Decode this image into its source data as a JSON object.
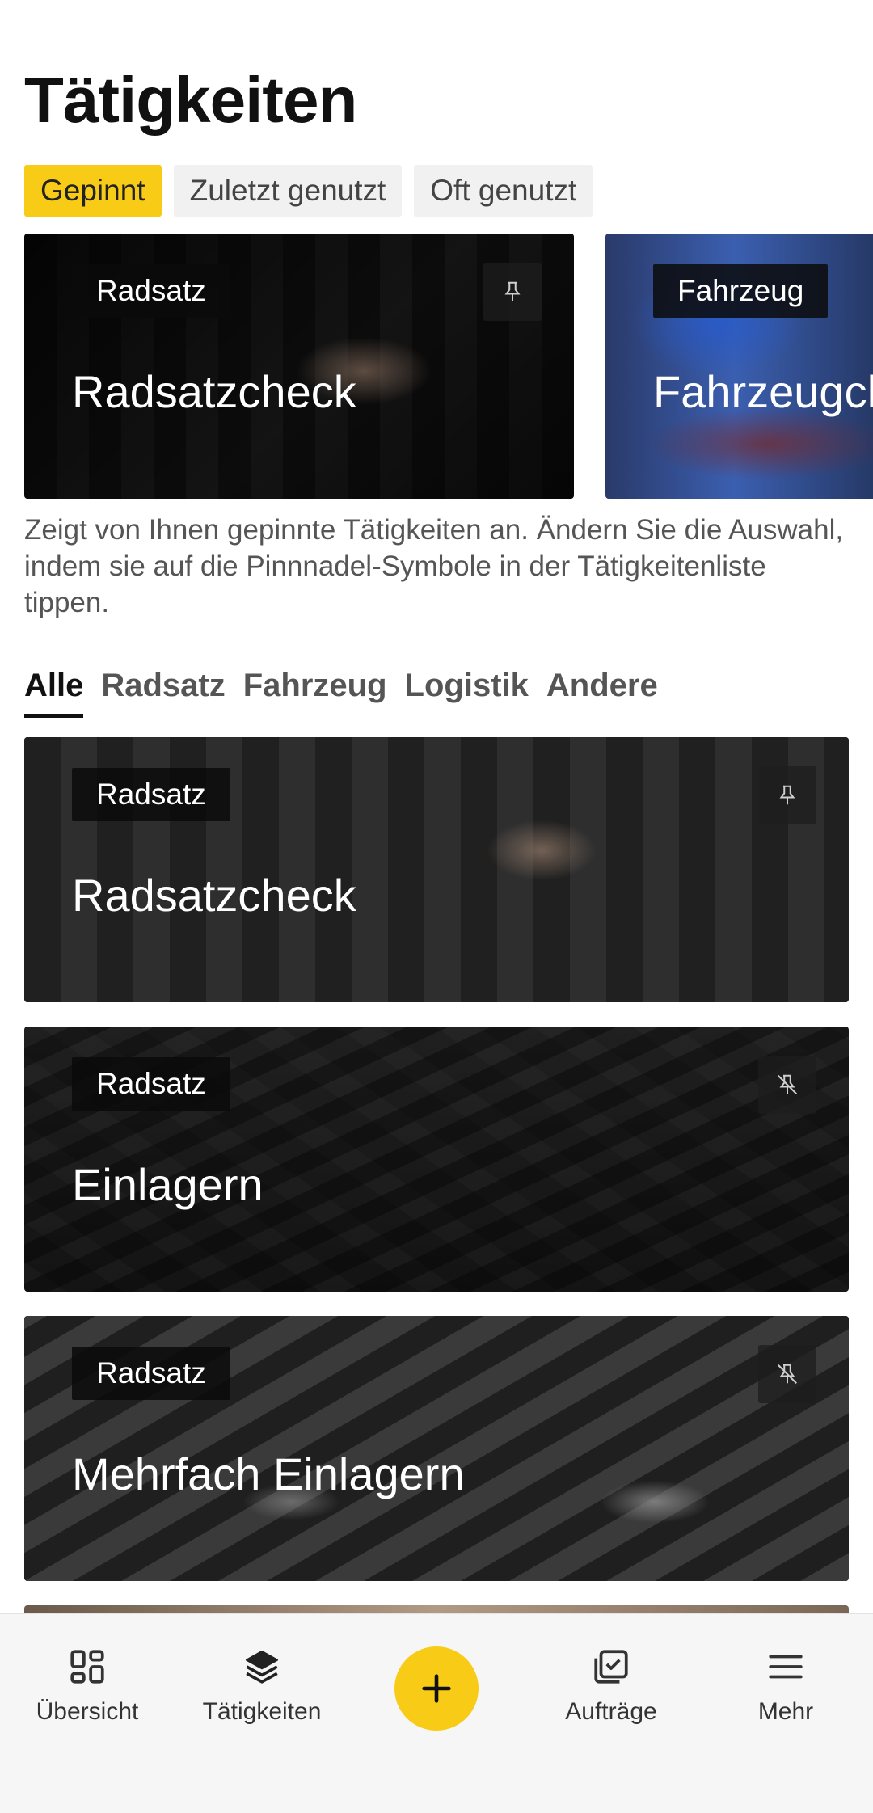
{
  "page_title": "Tätigkeiten",
  "filter_chips": [
    {
      "label": "Gepinnt",
      "active": true
    },
    {
      "label": "Zuletzt genutzt",
      "active": false
    },
    {
      "label": "Oft genutzt",
      "active": false
    }
  ],
  "pinned_cards": [
    {
      "tag": "Radsatz",
      "title": "Radsatzcheck",
      "pin_icon": "pin-icon"
    },
    {
      "tag": "Fahrzeug",
      "title": "Fahrzeugcheck"
    }
  ],
  "description": "Zeigt von Ihnen gepinnte Tätigkeiten an. Ändern Sie die Auswahl, indem sie auf die Pinnnadel-Symbole in der Tätigkeitenliste tippen.",
  "category_tabs": [
    {
      "label": "Alle",
      "active": true
    },
    {
      "label": "Radsatz",
      "active": false
    },
    {
      "label": "Fahrzeug",
      "active": false
    },
    {
      "label": "Logistik",
      "active": false
    },
    {
      "label": "Andere",
      "active": false
    }
  ],
  "activities": [
    {
      "tag": "Radsatz",
      "title": "Radsatzcheck",
      "pinned": true,
      "pin_icon": "pin-icon"
    },
    {
      "tag": "Radsatz",
      "title": "Einlagern",
      "pinned": false,
      "pin_icon": "pin-off-icon"
    },
    {
      "tag": "Radsatz",
      "title": "Mehrfach Einlagern",
      "pinned": false,
      "pin_icon": "pin-off-icon"
    }
  ],
  "bottom_nav": {
    "overview": {
      "label": "Übersicht",
      "icon": "grid-icon"
    },
    "activities": {
      "label": "Tätigkeiten",
      "icon": "layers-icon"
    },
    "add": {
      "icon": "plus-icon",
      "color": "#f8cb16"
    },
    "orders": {
      "label": "Aufträge",
      "icon": "checklist-icon"
    },
    "more": {
      "label": "Mehr",
      "icon": "menu-icon"
    }
  },
  "colors": {
    "accent": "#f8cb16",
    "text": "#111111",
    "muted": "#555555"
  }
}
